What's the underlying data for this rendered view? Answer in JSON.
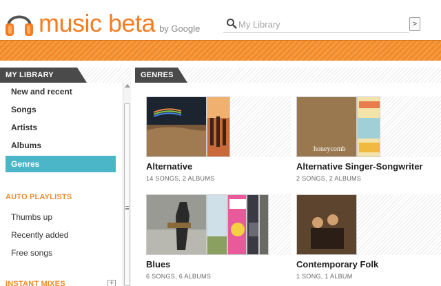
{
  "header": {
    "brand": "music beta",
    "brand_by": "by Google",
    "search_placeholder": "My Library",
    "search_button": ">"
  },
  "sidebar": {
    "tab_label": "MY LIBRARY",
    "items": [
      {
        "label": "New and recent",
        "active": false
      },
      {
        "label": "Songs",
        "active": false
      },
      {
        "label": "Artists",
        "active": false
      },
      {
        "label": "Albums",
        "active": false
      },
      {
        "label": "Genres",
        "active": true
      }
    ],
    "auto_playlists_head": "AUTO PLAYLISTS",
    "auto_playlists": [
      "Thumbs up",
      "Recently added",
      "Free songs"
    ],
    "instant_mixes_head": "INSTANT MIXES",
    "instant_mixes_add": "+"
  },
  "main": {
    "tab_label": "GENRES",
    "genres": [
      {
        "title": "Alternative",
        "subtitle": "14 SONGS, 2 ALBUMS"
      },
      {
        "title": "Alternative Singer-Songwriter",
        "subtitle": "2 SONGS, 2 ALBUMS",
        "cover_text": "honeycomb"
      },
      {
        "title": "Blues",
        "subtitle": "6 SONGS, 6 ALBUMS"
      },
      {
        "title": "Contemporary Folk",
        "subtitle": "1 SONG, 1 ALBUM"
      }
    ]
  },
  "colors": {
    "brand_orange": "#f57c22",
    "active_nav": "#4ab6c8",
    "tab_dark": "#4a4a4a"
  }
}
